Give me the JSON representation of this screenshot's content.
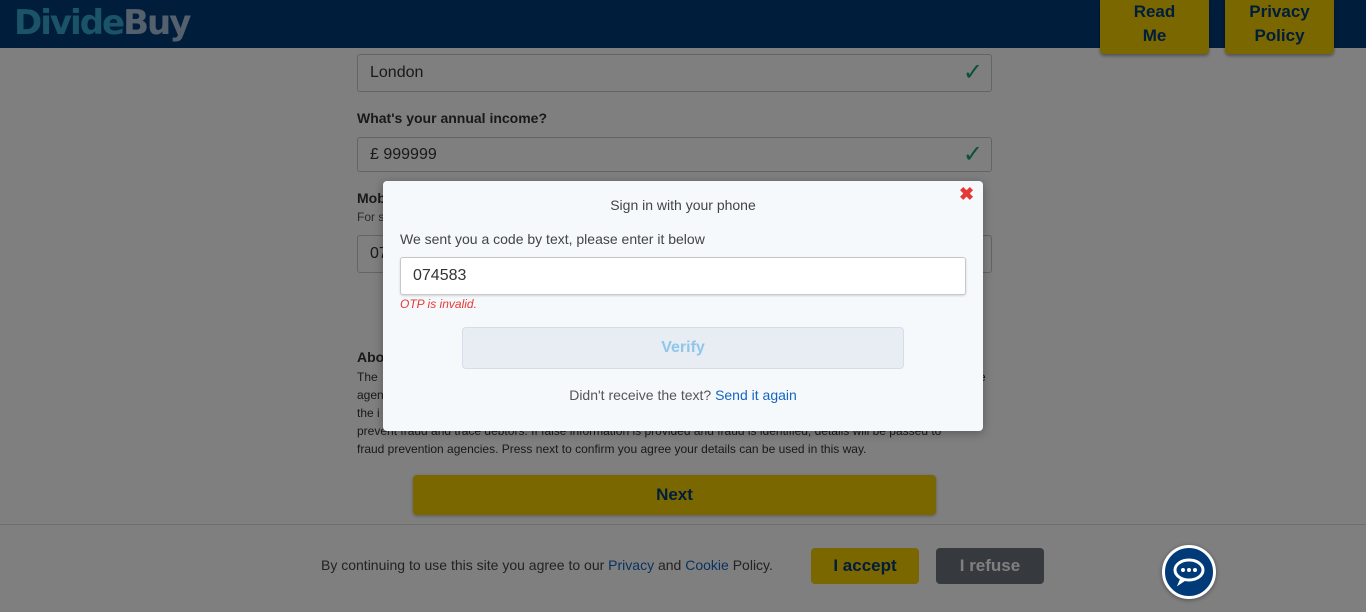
{
  "header": {
    "logo_part1": "Divide",
    "logo_part2": "Buy",
    "read_me_line1": "Read",
    "read_me_line2": "Me",
    "privacy_line1": "Privacy",
    "privacy_line2": "Policy"
  },
  "form": {
    "city_value": "London",
    "income_label": "What's your annual income?",
    "income_value": "£ 999999",
    "mobile_label_partial": "Mob",
    "mobile_sub_partial": "For s",
    "mobile_value_partial": "07",
    "about_label_partial": "Abo",
    "about_text_partial": [
      "The",
      "agen",
      "the i",
      "prevent fraud and trace debtors. If false information is provided and fraud is identified, details will be passed to",
      "fraud prevention agencies. Press next to confirm you agree your details can be used in this way."
    ],
    "about_text_right_partial": "e",
    "check_icon": "✓",
    "next_label": "Next"
  },
  "modal": {
    "title": "Sign in with your phone",
    "close_icon": "✖",
    "instruction": "We sent you a code by text, please enter it below",
    "otp_value": "074583",
    "error": "OTP is invalid.",
    "verify_label": "Verify",
    "resend_prefix": "Didn't receive the text?",
    "resend_link": "Send it again"
  },
  "cookie": {
    "text_prefix": "By continuing to use this site you agree to our",
    "privacy_link": "Privacy",
    "and": "and",
    "cookie_link": "Cookie",
    "text_suffix": "Policy.",
    "accept_label": "I accept",
    "refuse_label": "I refuse"
  },
  "colors": {
    "brand_navy": "#003a78",
    "brand_yellow": "#f5cf00",
    "error_red": "#e53935",
    "link_blue": "#1565c0"
  },
  "icons": [
    "check-icon",
    "close-icon",
    "chat-icon"
  ]
}
